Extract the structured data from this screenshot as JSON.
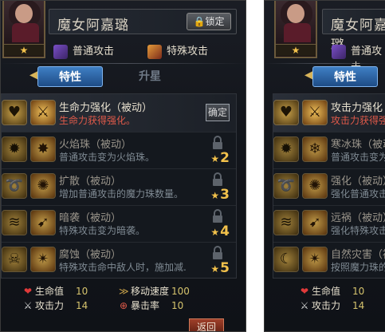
{
  "left": {
    "hero_name": "魔女阿嘉璐",
    "hero_stars": "★",
    "lock_label": "锁定",
    "skills": {
      "normal": "普通攻击",
      "special": "特殊攻击"
    },
    "tabs": {
      "trait": "特性",
      "upgrade": "升星"
    },
    "traits": [
      {
        "title": "生命力强化（被动）",
        "desc": "生命力获得强化。",
        "state": "active",
        "action": "确定"
      },
      {
        "title": "火焰珠（被动）",
        "desc": "普通攻击变为火焰珠。",
        "state": "locked",
        "stars": "2"
      },
      {
        "title": "扩散（被动）",
        "desc": "增加普通攻击的魔力珠数量。",
        "state": "locked",
        "stars": "3"
      },
      {
        "title": "暗袭（被动）",
        "desc": "特殊攻击变为暗袭。",
        "state": "locked",
        "stars": "4"
      },
      {
        "title": "腐蚀（被动）",
        "desc": "特殊攻击命中敌人时，施加减...",
        "state": "locked",
        "stars": "5"
      }
    ],
    "stats": [
      {
        "label": "生命值",
        "value": "10",
        "icon": "heart-icon"
      },
      {
        "label": "攻击力",
        "value": "14",
        "icon": "sword-icon"
      },
      {
        "label": "移动速度",
        "value": "100",
        "icon": "boot-icon"
      },
      {
        "label": "暴击率",
        "value": "10",
        "icon": "crosshair-icon"
      }
    ],
    "back_label": "返回"
  },
  "right": {
    "hero_name": "魔女阿嘉璐",
    "hero_stars": "★",
    "skills": {
      "normal": "普通攻击"
    },
    "tabs": {
      "trait": "特性"
    },
    "traits": [
      {
        "title": "攻击力强化",
        "desc": "攻击力获得强化"
      },
      {
        "title": "寒冰珠（被动）",
        "desc": "普通攻击变为"
      },
      {
        "title": "强化（被动）",
        "desc": "强化普通攻击"
      },
      {
        "title": "远祸（被动）",
        "desc": "强化特殊攻击"
      },
      {
        "title": "自然灾害（被",
        "desc": "按照魔力珠的"
      }
    ],
    "stats": [
      {
        "label": "生命值",
        "value": "10",
        "icon": "heart-icon"
      },
      {
        "label": "攻击力",
        "value": "14",
        "icon": "sword-icon"
      }
    ]
  },
  "colors": {
    "accent_gold": "#f2c14b",
    "active_desc_red": "#e05a4a",
    "tab_blue": "#3f7fc4",
    "stat_value": "#d6c36d"
  }
}
